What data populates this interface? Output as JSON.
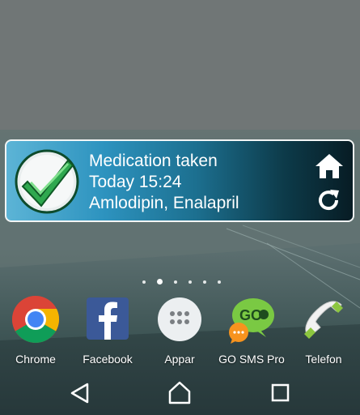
{
  "widget": {
    "line1": "Medication taken",
    "line2": "Today 15:24",
    "line3": "Amlodipin, Enalapril",
    "icons": {
      "status": "checkmark-icon",
      "home": "home-icon",
      "refresh": "refresh-icon"
    }
  },
  "pager": {
    "page_count": 6,
    "active_index": 1
  },
  "dock": {
    "apps": [
      {
        "label": "Chrome",
        "icon": "chrome-icon"
      },
      {
        "label": "Facebook",
        "icon": "facebook-icon"
      },
      {
        "label": "Appar",
        "icon": "app-drawer-icon"
      },
      {
        "label": "GO SMS Pro",
        "icon": "go-sms-icon"
      },
      {
        "label": "Telefon",
        "icon": "phone-icon"
      }
    ]
  },
  "go_sms": {
    "logo_text": "GO"
  },
  "navbar": {
    "buttons": [
      "back-icon",
      "home-icon",
      "recents-icon"
    ]
  }
}
